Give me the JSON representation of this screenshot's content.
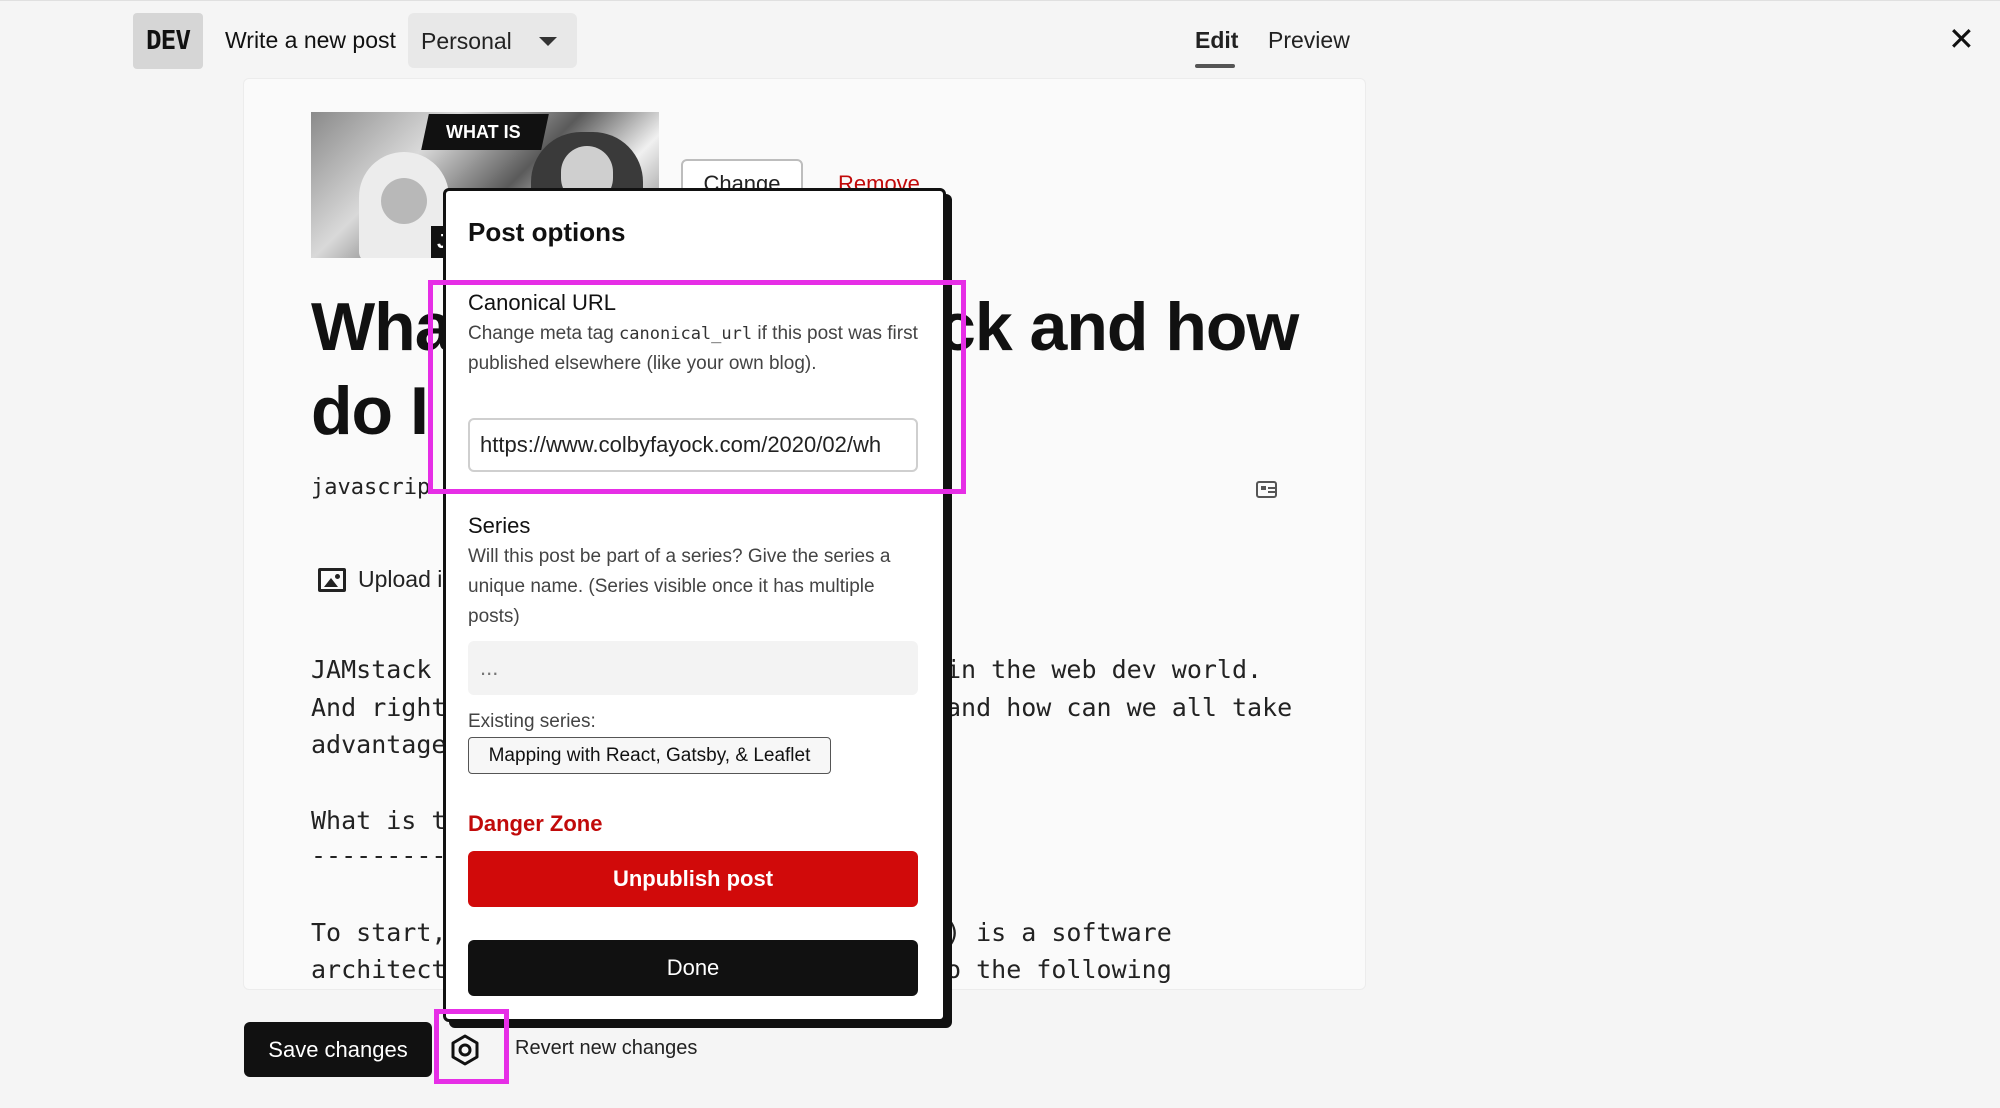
{
  "header": {
    "logo": "DEV",
    "title": "Write a new post",
    "org_selector": "Personal",
    "tabs": [
      {
        "label": "Edit"
      },
      {
        "label": "Preview"
      }
    ],
    "close": "✕"
  },
  "editor": {
    "cover_caption": "WHAT IS",
    "cover_tag": "JA",
    "change_button": "Change",
    "remove_button": "Remove",
    "title_left_1": "Wha",
    "title_right_1": "ck and how",
    "title_left_2": "do I",
    "tags": "javascrip",
    "upload_label": "Upload i",
    "body_lines": {
      "l1_left": "JAMstack",
      "l1_right": "in the web dev world.",
      "l2_left": "And right",
      "l2_right": "and how can we all take",
      "l3_left": "advantage",
      "l4_left": "What is t",
      "l5_left": "---------",
      "l6_left": "To start,",
      "l6_right": ") is a software",
      "l7_left": "architect",
      "l7_right": "o the following"
    }
  },
  "post_options": {
    "heading": "Post options",
    "canonical": {
      "label": "Canonical URL",
      "desc_before": "Change meta tag ",
      "desc_code": "canonical_url",
      "desc_after": " if this post was first published elsewhere (like your own blog).",
      "value": "https://www.colbyfayock.com/2020/02/wh"
    },
    "series": {
      "label": "Series",
      "desc": "Will this post be part of a series? Give the series a unique name. (Series visible once it has multiple posts)",
      "placeholder": "...",
      "existing_label": "Existing series:",
      "existing_item": "Mapping with React, Gatsby, & Leaflet"
    },
    "danger_zone": "Danger Zone",
    "unpublish_button": "Unpublish post",
    "done_button": "Done"
  },
  "footer": {
    "save_button": "Save changes",
    "revert_label": "Revert new changes"
  },
  "colors": {
    "highlight": "#e62ee6",
    "danger": "#d10a0a",
    "primary_dark": "#111111"
  }
}
